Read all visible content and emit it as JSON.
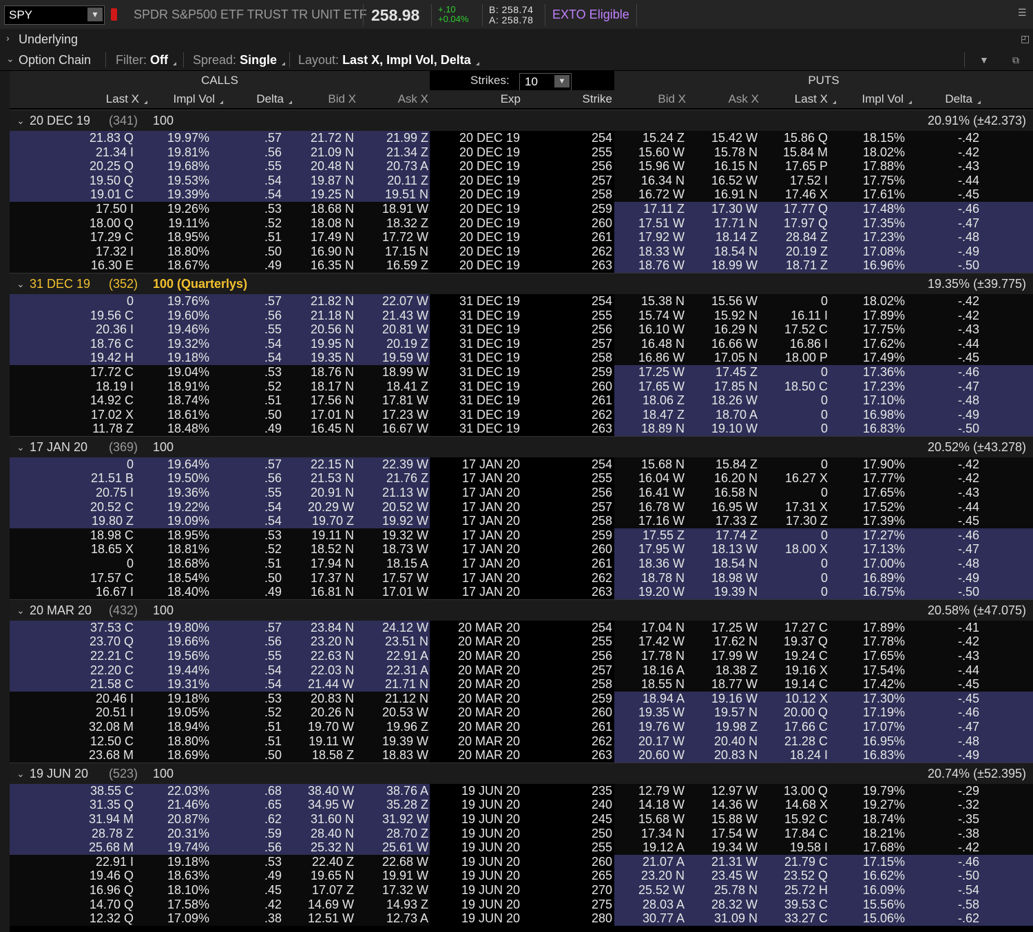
{
  "top": {
    "symbol": "SPY",
    "description": "SPDR S&P500 ETF TRUST TR UNIT ETF",
    "last": "258.98",
    "net_change": "+.10",
    "pct_change": "+0.04%",
    "bid": "B: 258.74",
    "ask": "A: 258.78",
    "exto": "EXTO Eligible"
  },
  "sections": {
    "underlying": "Underlying",
    "option_chain": "Option Chain",
    "filter_label": "Filter:",
    "filter_value": "Off",
    "spread_label": "Spread:",
    "spread_value": "Single",
    "layout_label": "Layout:",
    "layout_value": "Last X, Impl Vol, Delta"
  },
  "header": {
    "calls": "CALLS",
    "puts": "PUTS",
    "strikes_label": "Strikes:",
    "strikes_value": "10",
    "call_cols": [
      "Last X",
      "Impl Vol",
      "Delta",
      "Bid X",
      "Ask X"
    ],
    "exp": "Exp",
    "strike": "Strike",
    "put_cols": [
      "Bid X",
      "Ask X",
      "Last X",
      "Impl Vol",
      "Delta"
    ]
  },
  "colors": {
    "itm": "#2e2e58",
    "otm": "#0b0b0b",
    "quarterly": "#f2c12e",
    "change_up": "#2fcf2f",
    "exto": "#c080ff"
  },
  "groups": [
    {
      "exp": "20 DEC 19",
      "days": "(341)",
      "mult": "100",
      "iv": "20.91% (±42.373)",
      "quarterly": false,
      "rows": [
        [
          "21.83 Q",
          "19.97%",
          ".57",
          "21.72 N",
          "21.99 Z",
          "20 DEC 19",
          "254",
          "15.24 Z",
          "15.42 W",
          "15.86 Q",
          "18.15%",
          "-.42"
        ],
        [
          "21.34 I",
          "19.81%",
          ".56",
          "21.09 N",
          "21.34 Z",
          "20 DEC 19",
          "255",
          "15.60 W",
          "15.78 N",
          "15.84 M",
          "18.02%",
          "-.42"
        ],
        [
          "20.25 Q",
          "19.68%",
          ".55",
          "20.48 N",
          "20.73 A",
          "20 DEC 19",
          "256",
          "15.96 W",
          "16.15 N",
          "17.65 P",
          "17.88%",
          "-.43"
        ],
        [
          "19.50 Q",
          "19.53%",
          ".54",
          "19.87 N",
          "20.11 Z",
          "20 DEC 19",
          "257",
          "16.34 N",
          "16.52 W",
          "17.52 I",
          "17.75%",
          "-.44"
        ],
        [
          "19.01 C",
          "19.39%",
          ".54",
          "19.25 N",
          "19.51 N",
          "20 DEC 19",
          "258",
          "16.72 W",
          "16.91 N",
          "17.46 X",
          "17.61%",
          "-.45"
        ],
        [
          "17.50 I",
          "19.26%",
          ".53",
          "18.68 N",
          "18.91 W",
          "20 DEC 19",
          "259",
          "17.11 Z",
          "17.30 W",
          "17.77 Q",
          "17.48%",
          "-.46"
        ],
        [
          "18.00 Q",
          "19.11%",
          ".52",
          "18.08 N",
          "18.32 Z",
          "20 DEC 19",
          "260",
          "17.51 W",
          "17.71 N",
          "17.97 Q",
          "17.35%",
          "-.47"
        ],
        [
          "17.29 C",
          "18.95%",
          ".51",
          "17.49 N",
          "17.72 W",
          "20 DEC 19",
          "261",
          "17.92 W",
          "18.14 Z",
          "28.84 Z",
          "17.23%",
          "-.48"
        ],
        [
          "17.32 I",
          "18.80%",
          ".50",
          "16.90 N",
          "17.15 N",
          "20 DEC 19",
          "262",
          "18.33 W",
          "18.54 N",
          "20.19 Z",
          "17.08%",
          "-.49"
        ],
        [
          "16.30 E",
          "18.67%",
          ".49",
          "16.35 N",
          "16.59 Z",
          "20 DEC 19",
          "263",
          "18.76 W",
          "18.99 W",
          "18.71 Z",
          "16.96%",
          "-.50"
        ]
      ]
    },
    {
      "exp": "31 DEC 19",
      "days": "(352)",
      "mult": "100 (Quarterlys)",
      "iv": "19.35% (±39.775)",
      "quarterly": true,
      "rows": [
        [
          "0",
          "19.76%",
          ".57",
          "21.82 N",
          "22.07 W",
          "31 DEC 19",
          "254",
          "15.38 N",
          "15.56 W",
          "0",
          "18.02%",
          "-.42"
        ],
        [
          "19.56 C",
          "19.60%",
          ".56",
          "21.18 N",
          "21.43 W",
          "31 DEC 19",
          "255",
          "15.74 W",
          "15.92 N",
          "16.11 I",
          "17.89%",
          "-.42"
        ],
        [
          "20.36 I",
          "19.46%",
          ".55",
          "20.56 N",
          "20.81 W",
          "31 DEC 19",
          "256",
          "16.10 W",
          "16.29 N",
          "17.52 C",
          "17.75%",
          "-.43"
        ],
        [
          "18.76 C",
          "19.32%",
          ".54",
          "19.95 N",
          "20.19 Z",
          "31 DEC 19",
          "257",
          "16.48 N",
          "16.66 W",
          "16.86 I",
          "17.62%",
          "-.44"
        ],
        [
          "19.42 H",
          "19.18%",
          ".54",
          "19.35 N",
          "19.59 W",
          "31 DEC 19",
          "258",
          "16.86 W",
          "17.05 N",
          "18.00 P",
          "17.49%",
          "-.45"
        ],
        [
          "17.72 C",
          "19.04%",
          ".53",
          "18.76 N",
          "18.99 W",
          "31 DEC 19",
          "259",
          "17.25 W",
          "17.45 Z",
          "0",
          "17.36%",
          "-.46"
        ],
        [
          "18.19 I",
          "18.91%",
          ".52",
          "18.17 N",
          "18.41 Z",
          "31 DEC 19",
          "260",
          "17.65 W",
          "17.85 N",
          "18.50 C",
          "17.23%",
          "-.47"
        ],
        [
          "14.92 C",
          "18.74%",
          ".51",
          "17.56 N",
          "17.81 W",
          "31 DEC 19",
          "261",
          "18.06 Z",
          "18.26 W",
          "0",
          "17.10%",
          "-.48"
        ],
        [
          "17.02 X",
          "18.61%",
          ".50",
          "17.01 N",
          "17.23 W",
          "31 DEC 19",
          "262",
          "18.47 Z",
          "18.70 A",
          "0",
          "16.98%",
          "-.49"
        ],
        [
          "11.78 Z",
          "18.48%",
          ".49",
          "16.45 N",
          "16.67 W",
          "31 DEC 19",
          "263",
          "18.89 N",
          "19.10 W",
          "0",
          "16.83%",
          "-.50"
        ]
      ]
    },
    {
      "exp": "17 JAN 20",
      "days": "(369)",
      "mult": "100",
      "iv": "20.52% (±43.278)",
      "quarterly": false,
      "rows": [
        [
          "0",
          "19.64%",
          ".57",
          "22.15 N",
          "22.39 W",
          "17 JAN 20",
          "254",
          "15.68 N",
          "15.84 Z",
          "0",
          "17.90%",
          "-.42"
        ],
        [
          "21.51 B",
          "19.50%",
          ".56",
          "21.53 N",
          "21.76 Z",
          "17 JAN 20",
          "255",
          "16.04 W",
          "16.20 N",
          "16.27 X",
          "17.77%",
          "-.42"
        ],
        [
          "20.75 I",
          "19.36%",
          ".55",
          "20.91 N",
          "21.13 W",
          "17 JAN 20",
          "256",
          "16.41 W",
          "16.58 N",
          "0",
          "17.65%",
          "-.43"
        ],
        [
          "20.52 C",
          "19.22%",
          ".54",
          "20.29 W",
          "20.52 W",
          "17 JAN 20",
          "257",
          "16.78 W",
          "16.95 W",
          "17.31 X",
          "17.52%",
          "-.44"
        ],
        [
          "19.80 Z",
          "19.09%",
          ".54",
          "19.70 Z",
          "19.92 W",
          "17 JAN 20",
          "258",
          "17.16 W",
          "17.33 Z",
          "17.30 Z",
          "17.39%",
          "-.45"
        ],
        [
          "18.98 C",
          "18.95%",
          ".53",
          "19.11 N",
          "19.32 W",
          "17 JAN 20",
          "259",
          "17.55 Z",
          "17.74 Z",
          "0",
          "17.27%",
          "-.46"
        ],
        [
          "18.65 X",
          "18.81%",
          ".52",
          "18.52 N",
          "18.73 W",
          "17 JAN 20",
          "260",
          "17.95 W",
          "18.13 W",
          "18.00 X",
          "17.13%",
          "-.47"
        ],
        [
          "0",
          "18.68%",
          ".51",
          "17.94 N",
          "18.15 A",
          "17 JAN 20",
          "261",
          "18.36 W",
          "18.54 N",
          "0",
          "17.00%",
          "-.48"
        ],
        [
          "17.57 C",
          "18.54%",
          ".50",
          "17.37 N",
          "17.57 W",
          "17 JAN 20",
          "262",
          "18.78 N",
          "18.98 W",
          "0",
          "16.89%",
          "-.49"
        ],
        [
          "16.67 I",
          "18.40%",
          ".49",
          "16.81 N",
          "17.01 W",
          "17 JAN 20",
          "263",
          "19.20 W",
          "19.39 N",
          "0",
          "16.75%",
          "-.50"
        ]
      ]
    },
    {
      "exp": "20 MAR 20",
      "days": "(432)",
      "mult": "100",
      "iv": "20.58% (±47.075)",
      "quarterly": false,
      "rows": [
        [
          "37.53 C",
          "19.80%",
          ".57",
          "23.84 N",
          "24.12 W",
          "20 MAR 20",
          "254",
          "17.04 N",
          "17.25 W",
          "17.27 C",
          "17.89%",
          "-.41"
        ],
        [
          "23.70 Q",
          "19.66%",
          ".56",
          "23.20 N",
          "23.51 N",
          "20 MAR 20",
          "255",
          "17.42 W",
          "17.62 N",
          "19.37 Q",
          "17.78%",
          "-.42"
        ],
        [
          "22.21 C",
          "19.56%",
          ".55",
          "22.63 N",
          "22.91 A",
          "20 MAR 20",
          "256",
          "17.78 N",
          "17.99 W",
          "19.24 C",
          "17.65%",
          "-.43"
        ],
        [
          "22.20 C",
          "19.44%",
          ".54",
          "22.03 N",
          "22.31 A",
          "20 MAR 20",
          "257",
          "18.16 A",
          "18.38 Z",
          "19.16 X",
          "17.54%",
          "-.44"
        ],
        [
          "21.58 C",
          "19.31%",
          ".54",
          "21.44 W",
          "21.71 N",
          "20 MAR 20",
          "258",
          "18.55 N",
          "18.77 W",
          "19.14 C",
          "17.42%",
          "-.45"
        ],
        [
          "20.46 I",
          "19.18%",
          ".53",
          "20.83 N",
          "21.12 N",
          "20 MAR 20",
          "259",
          "18.94 A",
          "19.16 W",
          "10.12 X",
          "17.30%",
          "-.45"
        ],
        [
          "20.51 I",
          "19.05%",
          ".52",
          "20.26 N",
          "20.53 W",
          "20 MAR 20",
          "260",
          "19.35 W",
          "19.57 N",
          "20.00 Q",
          "17.19%",
          "-.46"
        ],
        [
          "32.08 M",
          "18.94%",
          ".51",
          "19.70 W",
          "19.96 Z",
          "20 MAR 20",
          "261",
          "19.76 W",
          "19.98 Z",
          "17.66 C",
          "17.07%",
          "-.47"
        ],
        [
          "12.50 C",
          "18.80%",
          ".51",
          "19.11 W",
          "19.39 W",
          "20 MAR 20",
          "262",
          "20.17 W",
          "20.40 N",
          "21.28 C",
          "16.95%",
          "-.48"
        ],
        [
          "23.68 M",
          "18.69%",
          ".50",
          "18.58 Z",
          "18.83 W",
          "20 MAR 20",
          "263",
          "20.60 W",
          "20.83 N",
          "18.24 I",
          "16.83%",
          "-.49"
        ]
      ]
    },
    {
      "exp": "19 JUN 20",
      "days": "(523)",
      "mult": "100",
      "iv": "20.74% (±52.395)",
      "quarterly": false,
      "rows": [
        [
          "38.55 C",
          "22.03%",
          ".68",
          "38.40 W",
          "38.76 A",
          "19 JUN 20",
          "235",
          "12.79 W",
          "12.97 W",
          "13.00 Q",
          "19.79%",
          "-.29"
        ],
        [
          "31.35 Q",
          "21.46%",
          ".65",
          "34.95 W",
          "35.28 Z",
          "19 JUN 20",
          "240",
          "14.18 W",
          "14.36 W",
          "14.68 X",
          "19.27%",
          "-.32"
        ],
        [
          "31.94 M",
          "20.87%",
          ".62",
          "31.60 N",
          "31.92 W",
          "19 JUN 20",
          "245",
          "15.68 W",
          "15.88 W",
          "15.92 C",
          "18.74%",
          "-.35"
        ],
        [
          "28.78 Z",
          "20.31%",
          ".59",
          "28.40 N",
          "28.70 Z",
          "19 JUN 20",
          "250",
          "17.34 N",
          "17.54 W",
          "17.84 C",
          "18.21%",
          "-.38"
        ],
        [
          "25.68 M",
          "19.74%",
          ".56",
          "25.32 N",
          "25.61 W",
          "19 JUN 20",
          "255",
          "19.12 A",
          "19.34 W",
          "19.58 I",
          "17.68%",
          "-.42"
        ],
        [
          "22.91 I",
          "19.18%",
          ".53",
          "22.40 Z",
          "22.68 W",
          "19 JUN 20",
          "260",
          "21.07 A",
          "21.31 W",
          "21.79 C",
          "17.15%",
          "-.46"
        ],
        [
          "19.46 Q",
          "18.63%",
          ".49",
          "19.65 N",
          "19.91 W",
          "19 JUN 20",
          "265",
          "23.20 N",
          "23.45 W",
          "23.52 Q",
          "16.62%",
          "-.50"
        ],
        [
          "16.96 Q",
          "18.10%",
          ".45",
          "17.07 Z",
          "17.32 W",
          "19 JUN 20",
          "270",
          "25.52 W",
          "25.78 N",
          "25.72 H",
          "16.09%",
          "-.54"
        ],
        [
          "14.70 Q",
          "17.58%",
          ".42",
          "14.69 W",
          "14.93 Z",
          "19 JUN 20",
          "275",
          "28.03 A",
          "28.32 W",
          "39.53 C",
          "15.56%",
          "-.58"
        ],
        [
          "12.32 Q",
          "17.09%",
          ".38",
          "12.51 W",
          "12.73 A",
          "19 JUN 20",
          "280",
          "30.77 A",
          "31.09 N",
          "33.27 C",
          "15.06%",
          "-.62"
        ]
      ]
    }
  ]
}
